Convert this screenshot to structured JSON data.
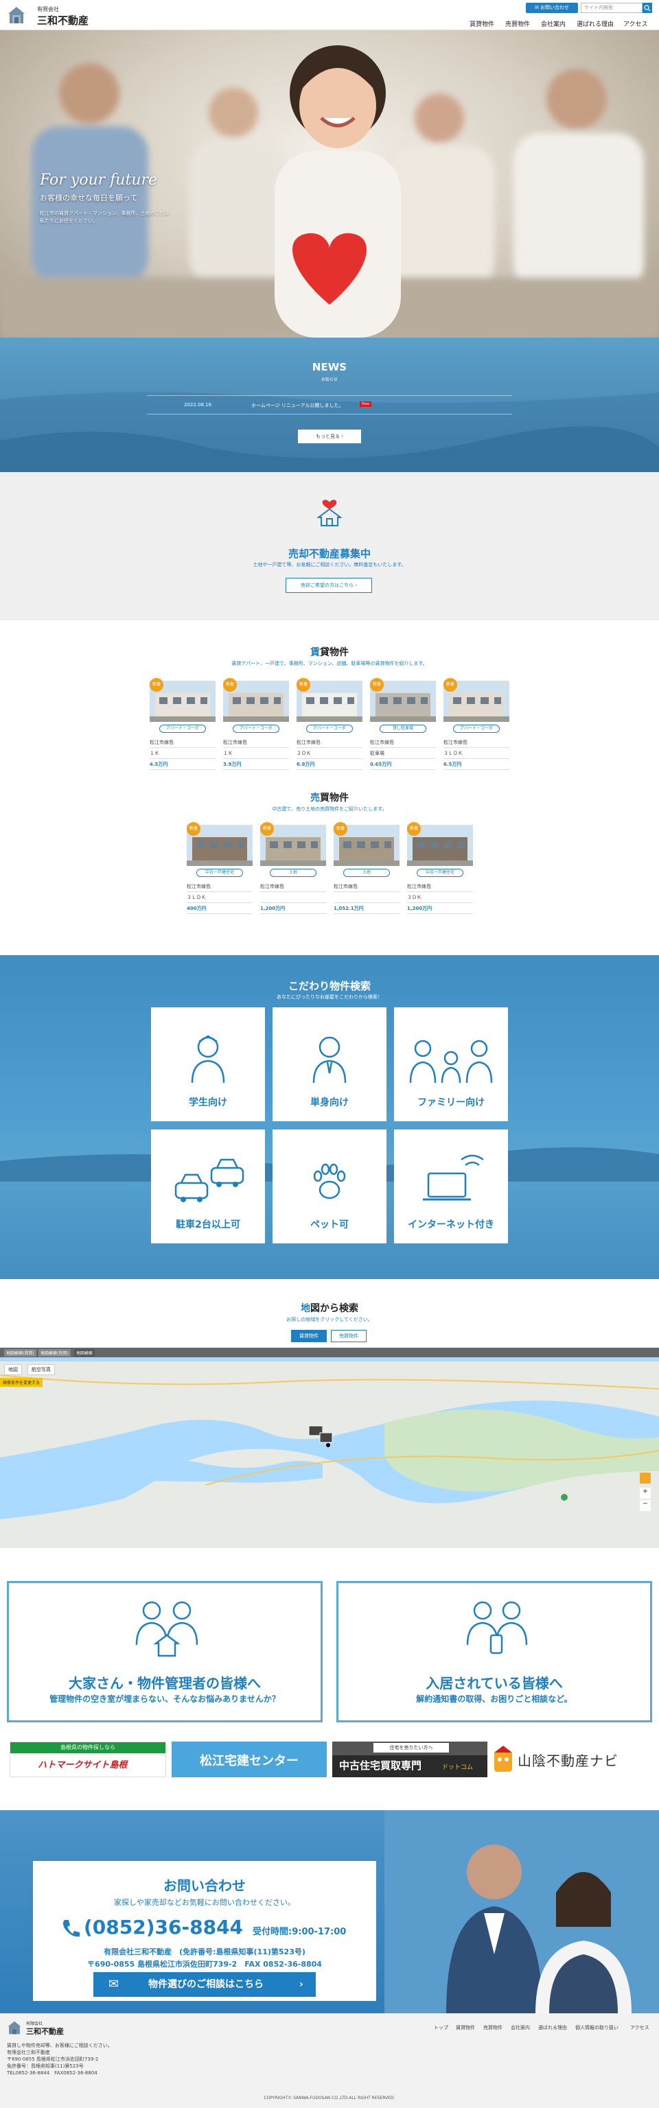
{
  "header": {
    "company_kind": "有限会社",
    "company_name": "三和不動産",
    "contact_btn": "お問い合わせ",
    "search_placeholder": "サイト内検索",
    "nav": [
      "賃貸物件",
      "売買物件",
      "会社案内",
      "選ばれる理由",
      "アクセス"
    ]
  },
  "hero": {
    "title": "For your future",
    "subtitle": "お客様の幸せな毎日を願って",
    "desc": "松江市の賃貸アパート・マンション、事務所、土地のことは\n私たちにお任せください。"
  },
  "news": {
    "title": "NEWS",
    "subtitle": "お知らせ",
    "items": [
      {
        "date": "2022.08.16",
        "text": "ホームページ リニューアル公開しました。",
        "badge": "New"
      }
    ],
    "more": "もっと見る"
  },
  "sell": {
    "title": "売却不動産募集中",
    "desc": "土地や一戸建て等、お気軽にご相談ください。無料査定もいたします。",
    "btn": "売却ご希望の方はこちら"
  },
  "rent": {
    "title_accent": "賃",
    "title_rest": "貸物件",
    "desc": "賃貸アパート、一戸建て、事務所、マンション、店舗、駐車場等の賃貸物件を紹介します。",
    "items": [
      {
        "badge": "新着",
        "tag": "アパート・コーポ",
        "area": "松江市嫁島",
        "layout": "１Ｋ",
        "price": "4.5万円"
      },
      {
        "badge": "新着",
        "tag": "アパート・コーポ",
        "area": "松江市嫁島",
        "layout": "１Ｋ",
        "price": "3.9万円"
      },
      {
        "badge": "新着",
        "tag": "アパート・コーポ",
        "area": "松江市嫁島",
        "layout": "２ＤＫ",
        "price": "6.9万円"
      },
      {
        "badge": "新着",
        "tag": "貸し駐車場",
        "area": "松江市嫁島",
        "layout": "駐車場",
        "price": "0.65万円"
      },
      {
        "badge": "新着",
        "tag": "アパート・コーポ",
        "area": "松江市嫁島",
        "layout": "３ＬＤＫ",
        "price": "6.5万円"
      }
    ]
  },
  "sale": {
    "title_accent": "売",
    "title_rest": "買物件",
    "desc": "中古建て、売り土地の売買物件をご紹介いたします。",
    "items": [
      {
        "badge": "新着",
        "tag": "中古一戸建住宅",
        "area": "松江市嫁島",
        "layout": "３ＬＤＫ",
        "price": "400万円"
      },
      {
        "badge": "新着",
        "tag": "土地",
        "area": "松江市嫁島",
        "layout": "",
        "price": "1,200万円"
      },
      {
        "badge": "新着",
        "tag": "土地",
        "area": "松江市嫁島",
        "layout": "",
        "price": "1,052.1万円"
      },
      {
        "badge": "新着",
        "tag": "中古一戸建住宅",
        "area": "松江市嫁島",
        "layout": "３ＤＫ",
        "price": "1,200万円"
      }
    ]
  },
  "kodawari": {
    "title": "こだわり物件検索",
    "desc": "あなたにぴったりなお部屋をこだわりから検索！",
    "tiles": [
      "学生向け",
      "単身向け",
      "ファミリー向け",
      "駐車2台以上可",
      "ペット可",
      "インターネット付き"
    ]
  },
  "mapsec": {
    "title_accent": "地",
    "title_rest": "図から検索",
    "desc": "お探しの地域をクリックしてください。",
    "tab_rent": "賃貸物件",
    "tab_sale": "売買物件",
    "map_tab1": "地図",
    "map_tab2": "航空写真",
    "filter": "検索条件を変更する",
    "top_chips": [
      "地図検索(賃貸)",
      "地図検索(売買)",
      "地図検索"
    ]
  },
  "owners": [
    {
      "title": "大家さん・物件管理者の皆様へ",
      "sub": "管理物件の空き室が埋まらない、そんなお悩みありませんか？"
    },
    {
      "title": "入居されている皆様へ",
      "sub": "解約通知書の取得、お困りごと相談など。"
    }
  ],
  "banners": {
    "b1_top": "島根県の物件探しなら",
    "b1_logo": "ハトマークサイト島根",
    "b2": "松江宅建センター",
    "b3_top": "住宅を売りたい方へ",
    "b3_main": "中古住宅買取専門",
    "b3_sub": "ドットコム",
    "b4": "山陰不動産ナビ"
  },
  "contact": {
    "title": "お問い合わせ",
    "desc": "家探しや家売却などお気軽にお問い合わせください。",
    "phone": "(0852)36-8844",
    "hours": "受付時間:9:00-17:00",
    "license": "有限会社三和不動産　(免許番号:島根県知事(11)第523号)",
    "address": "〒690-0855 島根県松江市浜佐田町739-2　FAX 0852-36-8804",
    "btn": "物件選びのご相談はこちら"
  },
  "footer": {
    "nav": [
      "トップ",
      "賃貸物件",
      "売買物件",
      "会社案内",
      "選ばれる理由",
      "個人情報の取り扱い",
      "アクセス"
    ],
    "company_kind": "有限会社",
    "company_name": "三和不動産",
    "info": [
      "賃貸しや物件売却等、お客様にご相談ください。",
      "有限会社三和不動産",
      "〒690-0855 島根県松江市浜佐田町739-2",
      "免許番号：島根県知事(11)第523号",
      "TEL0852-36-8844　FAX0852-36-8804"
    ],
    "copyright": "COPYRIGHT© SANWA-FUDOSAN CO.,LTD.ALL RIGHT RESERVED."
  },
  "colors": {
    "accent": "#1e7fc2",
    "badge": "#f0a11a",
    "section_blue": "#3f8dc1"
  }
}
